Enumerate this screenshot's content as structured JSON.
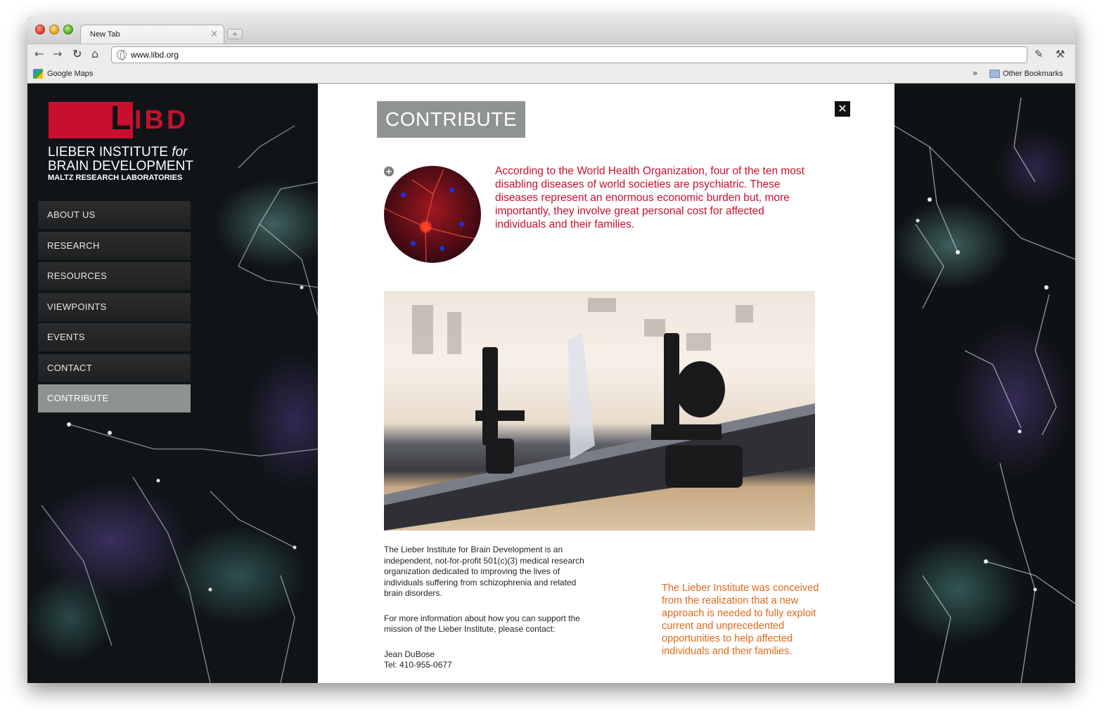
{
  "browser": {
    "tab_title": "New Tab",
    "tab_close": "×",
    "new_tab": "+",
    "url": "www.libd.org",
    "bookmark_1": "Google Maps",
    "bookmark_chevron": "»",
    "other_bookmarks": "Other Bookmarks"
  },
  "logo": {
    "mark_L": "L",
    "mark_IBD": "IBD",
    "line1_main": "LIEBER INSTITUTE ",
    "line1_italic": "for",
    "line2": "BRAIN DEVELOPMENT",
    "line3": "MALTZ RESEARCH LABORATORIES"
  },
  "nav": {
    "items": [
      "ABOUT US",
      "RESEARCH",
      "RESOURCES",
      "VIEWPOINTS",
      "EVENTS",
      "CONTACT",
      "CONTRIBUTE"
    ],
    "active": "CONTRIBUTE"
  },
  "panel": {
    "title": "CONTRIBUTE",
    "close": "✕",
    "plus": "+",
    "intro": "According to the World Health Organization, four of the ten most disabling diseases of world societies are psychiatric. These diseases represent an enormous economic burden but, more importantly, they involve great personal cost for affected individuals and their families.",
    "body_p1": "The Lieber Institute for Brain Development is an independent, not-for-profit 501(c)(3) medical research organization dedicated to improving the lives of individuals suffering from schizophrenia and related brain disorders.",
    "body_p2": "For more information about how you can support the mission of the Lieber Institute, please contact:",
    "contact_name": "Jean DuBose",
    "contact_tel": "Tel: 410-955-0677",
    "quote": "The Lieber Institute was conceived from the realization that a new approach is needed to fully exploit current and unprecedented opportunities to help affected individuals and their families."
  },
  "colors": {
    "brand_red": "#c8102e",
    "accent_orange": "#e06a1b",
    "nav_active": "#8e9290"
  }
}
